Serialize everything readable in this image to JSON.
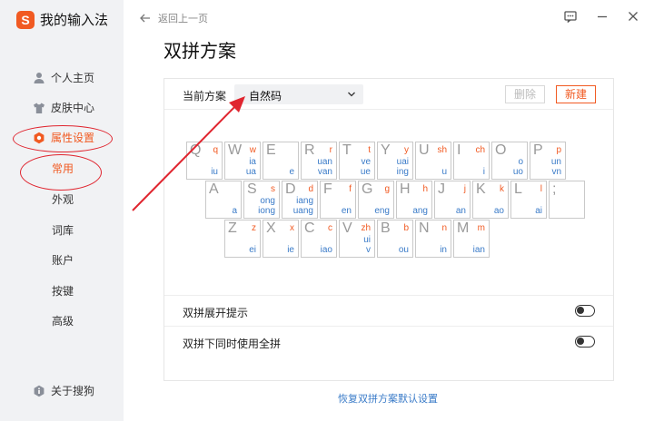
{
  "app": {
    "name": "我的输入法"
  },
  "sidebar": {
    "items": [
      {
        "label": "个人主页",
        "icon": "user-icon"
      },
      {
        "label": "皮肤中心",
        "icon": "shirt-icon"
      },
      {
        "label": "属性设置",
        "icon": "settings-icon",
        "active": true
      }
    ],
    "subitems": [
      "常用",
      "外观",
      "词库",
      "账户",
      "按键",
      "高级"
    ],
    "about": {
      "label": "关于搜狗",
      "icon": "info-icon"
    }
  },
  "topbar": {
    "back_label": "返回上一页"
  },
  "page": {
    "title": "双拼方案"
  },
  "scheme": {
    "label": "当前方案",
    "selected": "自然码",
    "delete_label": "删除",
    "new_label": "新建"
  },
  "keyboard": {
    "row1": [
      {
        "letter": "Q",
        "initial": "q",
        "finals": "iu"
      },
      {
        "letter": "W",
        "initial": "w",
        "finals": "ia\nua"
      },
      {
        "letter": "E",
        "initial": "",
        "finals": "e"
      },
      {
        "letter": "R",
        "initial": "r",
        "finals": "uan\nvan"
      },
      {
        "letter": "T",
        "initial": "t",
        "finals": "ve\nue"
      },
      {
        "letter": "Y",
        "initial": "y",
        "finals": "uai\ning"
      },
      {
        "letter": "U",
        "initial": "sh",
        "finals": "u"
      },
      {
        "letter": "I",
        "initial": "ch",
        "finals": "i"
      },
      {
        "letter": "O",
        "initial": "",
        "finals": "o\nuo"
      },
      {
        "letter": "P",
        "initial": "p",
        "finals": "un\nvn"
      }
    ],
    "row2": [
      {
        "letter": "A",
        "initial": "",
        "finals": "a"
      },
      {
        "letter": "S",
        "initial": "s",
        "finals": "ong\niong"
      },
      {
        "letter": "D",
        "initial": "d",
        "finals": "iang\nuang"
      },
      {
        "letter": "F",
        "initial": "f",
        "finals": "en"
      },
      {
        "letter": "G",
        "initial": "g",
        "finals": "eng"
      },
      {
        "letter": "H",
        "initial": "h",
        "finals": "ang"
      },
      {
        "letter": "J",
        "initial": "j",
        "finals": "an"
      },
      {
        "letter": "K",
        "initial": "k",
        "finals": "ao"
      },
      {
        "letter": "L",
        "initial": "l",
        "finals": "ai"
      },
      {
        "letter": ";",
        "initial": "",
        "finals": ""
      }
    ],
    "row3": [
      {
        "letter": "Z",
        "initial": "z",
        "finals": "ei"
      },
      {
        "letter": "X",
        "initial": "x",
        "finals": "ie"
      },
      {
        "letter": "C",
        "initial": "c",
        "finals": "iao"
      },
      {
        "letter": "V",
        "initial": "zh",
        "finals": "ui\nv"
      },
      {
        "letter": "B",
        "initial": "b",
        "finals": "ou"
      },
      {
        "letter": "N",
        "initial": "n",
        "finals": "in"
      },
      {
        "letter": "M",
        "initial": "m",
        "finals": "ian"
      }
    ]
  },
  "options": [
    {
      "label": "双拼展开提示",
      "on": false
    },
    {
      "label": "双拼下同时使用全拼",
      "on": false
    }
  ],
  "restore_label": "恢复双拼方案默认设置",
  "colors": {
    "accent": "#f15a22",
    "link": "#3a7bc8",
    "annotation": "#e0252f"
  }
}
